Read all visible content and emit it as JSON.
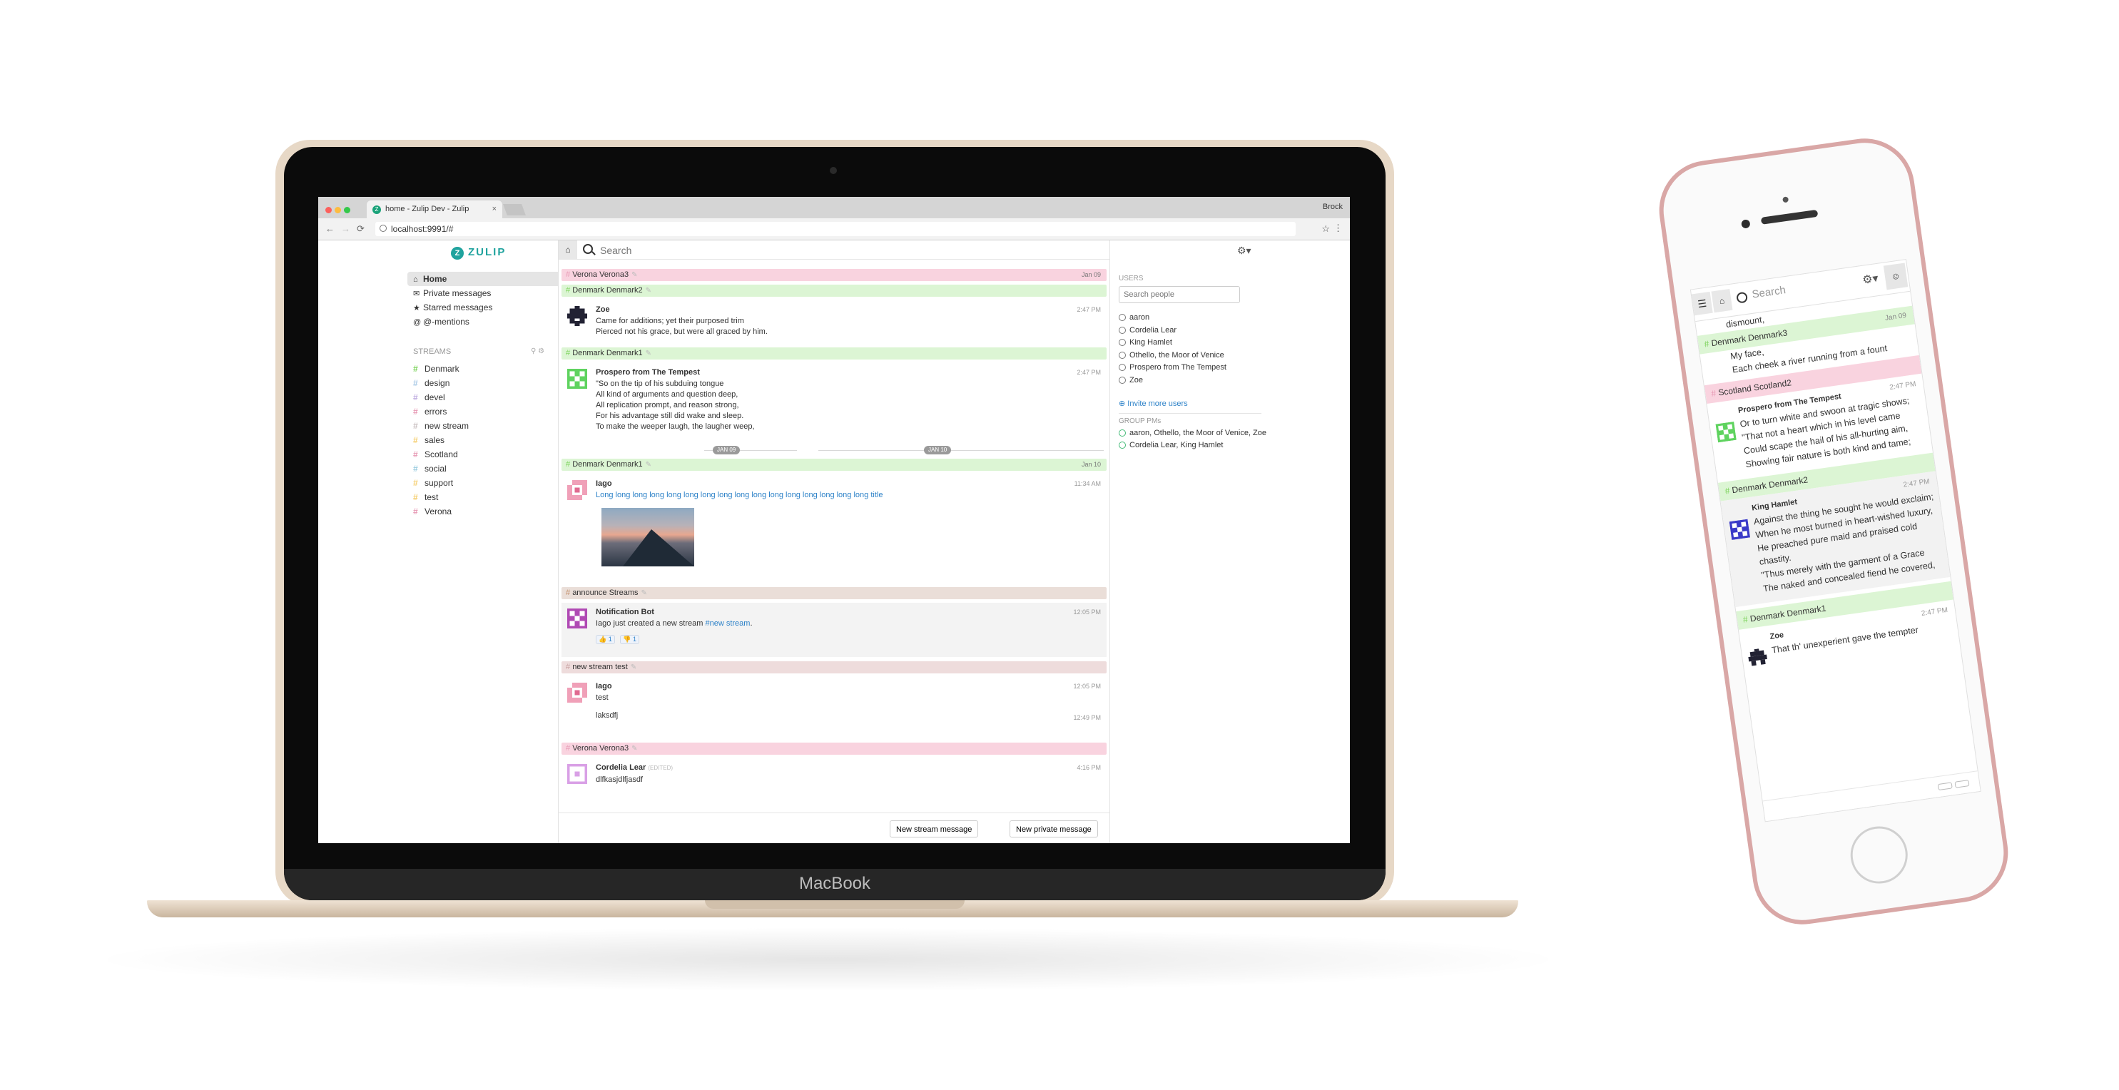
{
  "colors": {
    "zulip_green": "#20a39e",
    "link_blue": "#2d82c8",
    "denmark": "#dcf5d4",
    "verona": "#f9d3df",
    "announce": "#eaded8",
    "new_stream": "#eedcdc",
    "scotland": "#f9d3df"
  },
  "browser": {
    "tab_title": "home - Zulip Dev - Zulip",
    "tab_close": "×",
    "profile": "Brock",
    "url": "localhost:9991/#",
    "back": "←",
    "forward": "→",
    "reload": "⟳",
    "star": "☆",
    "menu": "⋮"
  },
  "laptop": {
    "brand": "MacBook"
  },
  "zulip": {
    "logo_mark": "Z",
    "logo_text": "ZULIP",
    "nav": [
      {
        "icon": "⌂",
        "label": "Home"
      },
      {
        "icon": "✉",
        "label": "Private messages"
      },
      {
        "icon": "★",
        "label": "Starred messages"
      },
      {
        "icon": "@",
        "label": "@-mentions"
      }
    ],
    "streams_header": "STREAMS",
    "streams": [
      {
        "name": "Denmark",
        "color": "#7cd35b"
      },
      {
        "name": "design",
        "color": "#a6c7e5"
      },
      {
        "name": "devel",
        "color": "#c2b0e2"
      },
      {
        "name": "errors",
        "color": "#e79ab5"
      },
      {
        "name": "new stream",
        "color": "#c8bebf"
      },
      {
        "name": "sales",
        "color": "#f5ce6e"
      },
      {
        "name": "Scotland",
        "color": "#e79ab5"
      },
      {
        "name": "social",
        "color": "#9ccde0"
      },
      {
        "name": "support",
        "color": "#f5ce6e"
      },
      {
        "name": "test",
        "color": "#f5ce6e"
      },
      {
        "name": "Verona",
        "color": "#e79ab5"
      }
    ],
    "search_placeholder": "Search",
    "feed": {
      "r1": {
        "stream": "Verona",
        "topic": "Verona3",
        "date": "Jan 09"
      },
      "r2": {
        "stream": "Denmark",
        "topic": "Denmark2"
      },
      "m1": {
        "sender": "Zoe",
        "time": "2:47 PM",
        "lines": [
          "Came for additions; yet their purposed trim",
          "Pierced not his grace, but were all graced by him."
        ]
      },
      "r3": {
        "stream": "Denmark",
        "topic": "Denmark1"
      },
      "m2": {
        "sender": "Prospero from The Tempest",
        "time": "2:47 PM",
        "lines": [
          "\"So on the tip of his subduing tongue",
          "All kind of arguments and question deep,",
          "All replication prompt, and reason strong,",
          "For his advantage still did wake and sleep.",
          "To make the weeper laugh, the laugher weep,"
        ]
      },
      "sep1": "JAN 09",
      "sep2": "JAN 10",
      "r4": {
        "stream": "Denmark",
        "topic": "Denmark1",
        "date": "Jan 10"
      },
      "m3": {
        "sender": "Iago",
        "time": "11:34 AM",
        "link": "Long long long long long long long long long long long long long long long long title"
      },
      "r5": {
        "stream": "announce",
        "topic": "Streams"
      },
      "m4": {
        "sender": "Notification Bot",
        "time": "12:05 PM",
        "text": "Iago just created a new stream ",
        "link": "#new stream",
        "tail": ".",
        "reactions": [
          {
            "e": "👍",
            "n": "1"
          },
          {
            "e": "👎",
            "n": "1"
          }
        ]
      },
      "r6": {
        "stream": "new stream",
        "topic": "test"
      },
      "m5": {
        "sender": "Iago",
        "time": "12:05 PM",
        "text": "test",
        "time2": "12:49 PM",
        "text2": "laksdfj"
      },
      "r7": {
        "stream": "Verona",
        "topic": "Verona3"
      },
      "m6": {
        "sender": "Cordelia Lear",
        "edited": "(EDITED)",
        "time": "4:16 PM",
        "text": "dlfkasjdlfjasdf"
      }
    },
    "compose": {
      "stream_btn": "New stream message",
      "private_btn": "New private message"
    },
    "right": {
      "users_header": "USERS",
      "search_people": "Search people",
      "users": [
        "aaron",
        "Cordelia Lear",
        "King Hamlet",
        "Othello, the Moor of Venice",
        "Prospero from The Tempest",
        "Zoe"
      ],
      "invite": "Invite more users",
      "group_header": "GROUP PMs",
      "groups": [
        "aaron, Othello, the Moor of Venice, Zoe",
        "Cordelia Lear, King Hamlet"
      ]
    }
  },
  "phone": {
    "search": "Search",
    "feed": {
      "partial1": "dismount,",
      "h1": {
        "stream": "Denmark",
        "topic": "Denmark3",
        "date": "Jan 09"
      },
      "partial2": "My face,",
      "partial3": "Each cheek a river running from a fount",
      "h2": {
        "stream": "Scotland",
        "topic": "Scotland2"
      },
      "m1": {
        "sender": "Prospero from The Tempest",
        "time": "2:47 PM",
        "lines": [
          "Or to turn white and swoon at tragic shows;",
          "\"That not a heart which in his level came",
          "Could scape the hail of his all-hurting aim,",
          "Showing fair nature is both kind and tame;"
        ]
      },
      "h3": {
        "stream": "Denmark",
        "topic": "Denmark2"
      },
      "m2": {
        "sender": "King Hamlet",
        "time": "2:47 PM",
        "lines": [
          "Against the thing he sought he would exclaim;",
          "When he most burned in heart-wished luxury,",
          "He preached pure maid and praised cold chastity.",
          "\"Thus merely with the garment of a Grace",
          "The naked and concealed fiend he covered,"
        ]
      },
      "h4": {
        "stream": "Denmark",
        "topic": "Denmark1"
      },
      "m3": {
        "sender": "Zoe",
        "time": "2:47 PM",
        "partial": "That th' unexperient gave the tempter"
      }
    }
  }
}
